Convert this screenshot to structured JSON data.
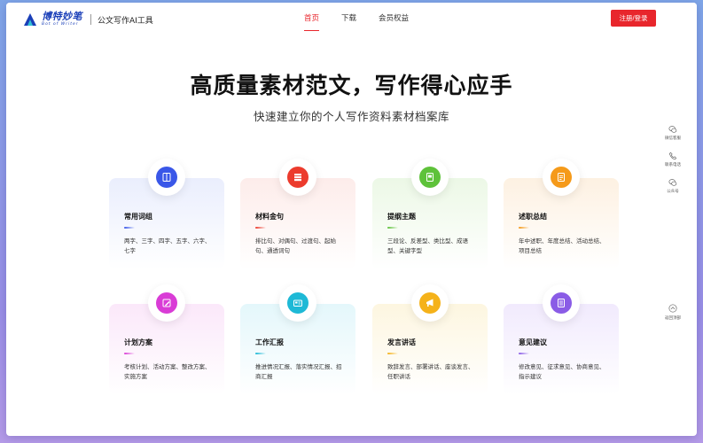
{
  "header": {
    "logo_cn": "博特妙笔",
    "logo_en": "Bot of Writer",
    "logo_sub": "公文写作AI工具",
    "nav": [
      {
        "label": "首页",
        "active": true
      },
      {
        "label": "下载",
        "active": false
      },
      {
        "label": "会员权益",
        "active": false
      }
    ],
    "login_label": "注册/登录"
  },
  "hero": {
    "title": "高质量素材范文，写作得心应手",
    "subtitle": "快速建立你的个人写作资料素材档案库"
  },
  "cards": [
    {
      "title": "常用词组",
      "desc": "两字、三字、四字、五字、六字、七字",
      "icon": "book-icon",
      "accent": "#3a57e8",
      "bar": "#3a57e8",
      "bg": "#eaeefd"
    },
    {
      "title": "材料金句",
      "desc": "排比句、对偶句、过渡句、起始句、通透词句",
      "icon": "stack-icon",
      "accent": "#ec3b2d",
      "bar": "#ec3b2d",
      "bg": "#fdecea"
    },
    {
      "title": "提纲主题",
      "desc": "三段论、反差型、类比型、成语型、关键字型",
      "icon": "outline-icon",
      "accent": "#5ec23a",
      "bar": "#5ec23a",
      "bg": "#ecf8e6"
    },
    {
      "title": "述职总结",
      "desc": "年中述职、年度总结、活动总结、项目总结",
      "icon": "report-icon",
      "accent": "#f59a1a",
      "bar": "#f59a1a",
      "bg": "#fdf1e2"
    },
    {
      "title": "计划方案",
      "desc": "考核计划、活动方案、整改方案、实施方案",
      "icon": "pen-icon",
      "accent": "#d93cd6",
      "bar": "#d93cd6",
      "bg": "#fbe8fa"
    },
    {
      "title": "工作汇报",
      "desc": "推进情况汇报、落实情况汇报、招商汇报",
      "icon": "card-icon",
      "accent": "#1eb9d6",
      "bar": "#1eb9d6",
      "bg": "#e4f7fb"
    },
    {
      "title": "发言讲话",
      "desc": "致辞发言、部署讲话、座谈发言、任职讲话",
      "icon": "megaphone-icon",
      "accent": "#f5b21a",
      "bar": "#f5b21a",
      "bg": "#fdf6e0"
    },
    {
      "title": "意见建议",
      "desc": "修改意见、征求意见、协商意见、指示建议",
      "icon": "doc-icon",
      "accent": "#8a5ce6",
      "bar": "#8a5ce6",
      "bg": "#f1eafd"
    }
  ],
  "side": {
    "items": [
      {
        "label": "微信客服",
        "icon": "wechat-icon"
      },
      {
        "label": "联系电话",
        "icon": "phone-icon"
      },
      {
        "label": "公众号",
        "icon": "wechat-official-icon"
      }
    ],
    "back_top_label": "返回顶部"
  },
  "colors": {
    "brand": "#1a3fb8",
    "accent_red": "#e8262c"
  }
}
